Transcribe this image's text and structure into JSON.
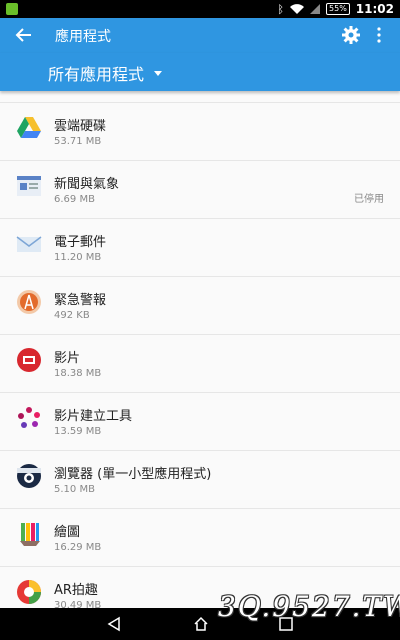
{
  "status_bar": {
    "battery": "55%",
    "time": "11:02"
  },
  "toolbar": {
    "title": "應用程式"
  },
  "filter": {
    "selected": "所有應用程式"
  },
  "apps": [
    {
      "name": "雲端硬碟",
      "size": "53.71 MB",
      "status": ""
    },
    {
      "name": "新聞與氣象",
      "size": "6.69 MB",
      "status": "已停用"
    },
    {
      "name": "電子郵件",
      "size": "11.20 MB",
      "status": ""
    },
    {
      "name": "緊急警報",
      "size": "492 KB",
      "status": ""
    },
    {
      "name": "影片",
      "size": "18.38 MB",
      "status": ""
    },
    {
      "name": "影片建立工具",
      "size": "13.59 MB",
      "status": ""
    },
    {
      "name": "瀏覽器 (單一小型應用程式)",
      "size": "5.10 MB",
      "status": ""
    },
    {
      "name": "繪圖",
      "size": "16.29 MB",
      "status": ""
    },
    {
      "name": "AR拍趣",
      "size": "30.49 MB",
      "status": ""
    }
  ],
  "watermark": "3Q.9527.TW",
  "colors": {
    "accent": "#2f96e1",
    "status_bar": "#000000"
  }
}
